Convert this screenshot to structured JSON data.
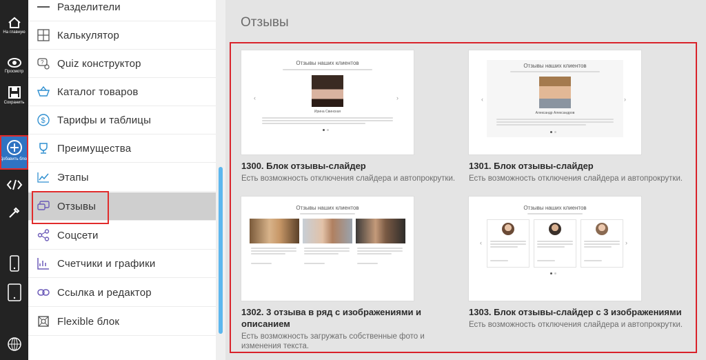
{
  "toolbar": {
    "home_caption": "На главную",
    "preview_caption": "Просмотр",
    "save_caption": "Сохранить",
    "add_caption": "Добавить блок"
  },
  "menu": {
    "items": [
      {
        "label": "Разделители",
        "icon": "divider-icon"
      },
      {
        "label": "Калькулятор",
        "icon": "calculator-icon"
      },
      {
        "label": "Quiz конструктор",
        "icon": "quiz-icon"
      },
      {
        "label": "Каталог товаров",
        "icon": "basket-icon"
      },
      {
        "label": "Тарифы и таблицы",
        "icon": "dollar-icon"
      },
      {
        "label": "Преимущества",
        "icon": "trophy-icon"
      },
      {
        "label": "Этапы",
        "icon": "chart-icon"
      },
      {
        "label": "Отзывы",
        "icon": "reviews-icon"
      },
      {
        "label": "Соцсети",
        "icon": "share-icon"
      },
      {
        "label": "Счетчики и графики",
        "icon": "counter-icon"
      },
      {
        "label": "Ссылка и редактор",
        "icon": "link-icon"
      },
      {
        "label": "Flexible блок",
        "icon": "flexible-icon"
      }
    ],
    "active_index": 7
  },
  "main": {
    "title": "Отзывы",
    "cards": [
      {
        "title": "1300. Блок отзывы-слайдер",
        "desc": "Есть возможность отключения слайдера и автопрокрутки.",
        "preview_heading": "Отзывы наших клиентов",
        "preview_name": "Ирина Свинская"
      },
      {
        "title": "1301. Блок отзывы-слайдер",
        "desc": "Есть возможность отключения слайдера и автопрокрутки.",
        "preview_heading": "Отзывы наших клиентов",
        "preview_name": "Александр Александров"
      },
      {
        "title": "1302. 3 отзыва в ряд с изображениями и описанием",
        "desc": "Есть возможность загружать собственные фото и изменения текста.",
        "preview_heading": "Отзывы наших клиентов"
      },
      {
        "title": "1303. Блок отзывы-слайдер с 3 изображениями",
        "desc": "Есть возможность отключения слайдера и автопрокрутки.",
        "preview_heading": "Отзывы наших клиентов"
      }
    ]
  },
  "colors": {
    "accent_blue": "#2f73c2",
    "highlight_red": "#e12b2b",
    "scroll_thumb": "#5db7ee",
    "menu_icon": "#2f8fd0"
  }
}
